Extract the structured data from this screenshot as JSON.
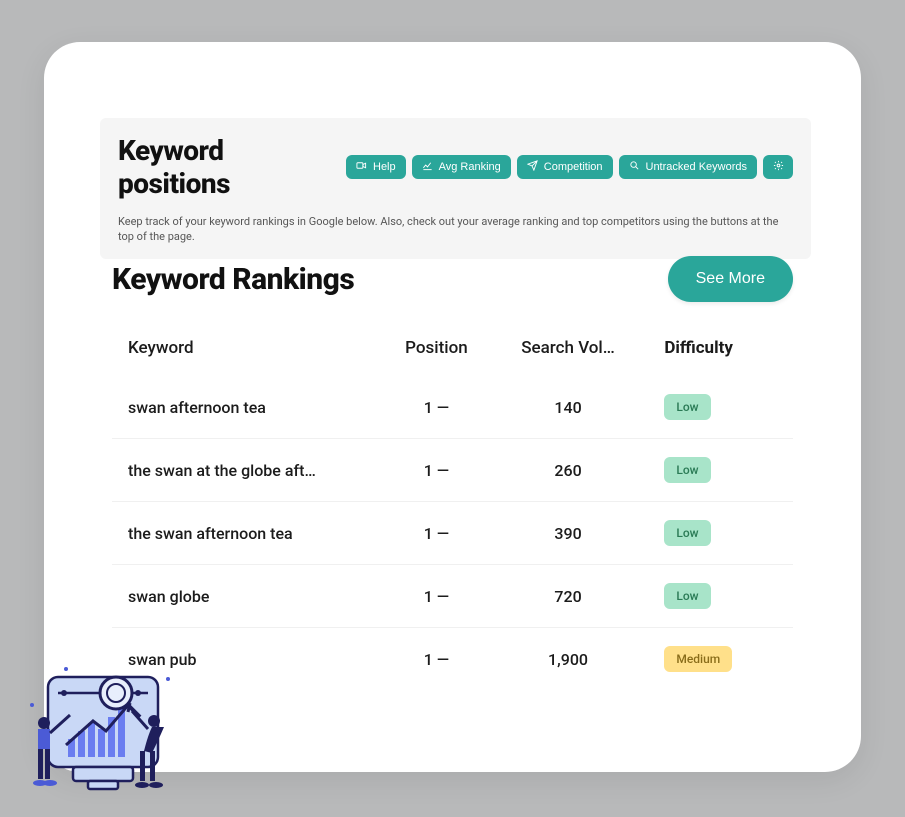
{
  "header": {
    "title": "Keyword positions",
    "subtitle": "Keep track of your keyword rankings in Google below. Also, check out your average ranking and top competitors using the buttons at the top of the page.",
    "toolbar": {
      "help": "Help",
      "avg_ranking": "Avg Ranking",
      "competition": "Competition",
      "untracked": "Untracked Keywords"
    }
  },
  "section": {
    "title": "Keyword Rankings",
    "see_more": "See More"
  },
  "table": {
    "columns": {
      "keyword": "Keyword",
      "position": "Position",
      "volume": "Search Vol…",
      "difficulty": "Difficulty"
    },
    "rows": [
      {
        "keyword": "swan afternoon tea",
        "position": "1 —",
        "volume": "140",
        "difficulty": "Low"
      },
      {
        "keyword": "the swan at the globe aft…",
        "position": "1 —",
        "volume": "260",
        "difficulty": "Low"
      },
      {
        "keyword": "the swan afternoon tea",
        "position": "1 —",
        "volume": "390",
        "difficulty": "Low"
      },
      {
        "keyword": "swan globe",
        "position": "1 —",
        "volume": "720",
        "difficulty": "Low"
      },
      {
        "keyword": "swan pub",
        "position": "1 —",
        "volume": "1,900",
        "difficulty": "Medium"
      }
    ]
  },
  "colors": {
    "accent": "#2aa69a",
    "badge_low_bg": "#a8e4c9",
    "badge_medium_bg": "#ffe08a"
  }
}
